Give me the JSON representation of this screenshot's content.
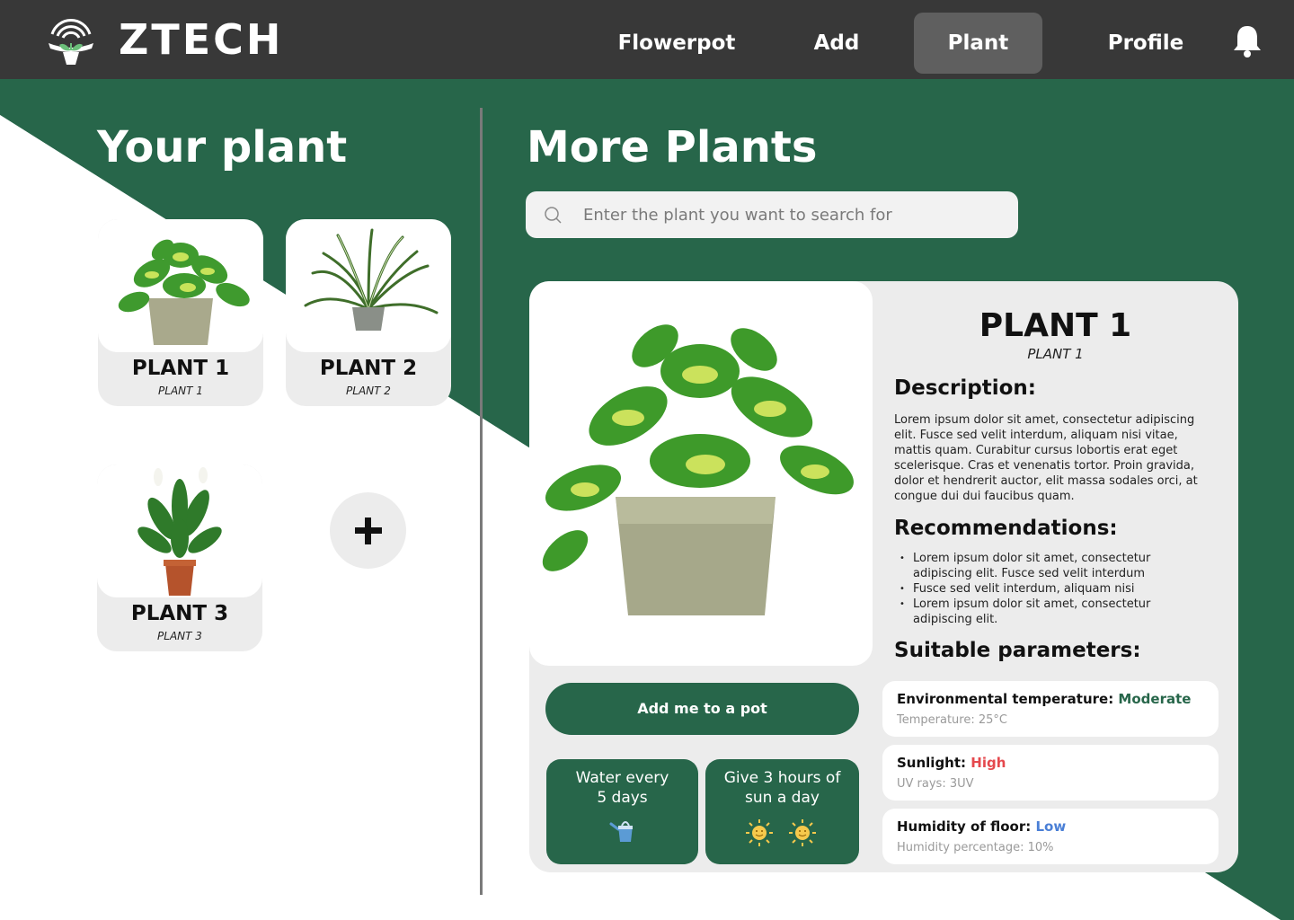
{
  "brand": {
    "name": "ZTECH"
  },
  "nav": {
    "items": [
      {
        "label": "Flowerpot"
      },
      {
        "label": "Add"
      },
      {
        "label": "Plant",
        "active": true
      },
      {
        "label": "Profile"
      }
    ]
  },
  "colors": {
    "header": "#383838",
    "accent": "#27664a",
    "active_tab": "#5f5f5f",
    "high": "#e5484d",
    "moderate": "#27664a",
    "low": "#4a7fd6"
  },
  "your_plants": {
    "title": "Your plant",
    "cards": [
      {
        "name": "PLANT 1",
        "sub": "PLANT 1"
      },
      {
        "name": "PLANT 2",
        "sub": "PLANT 2"
      },
      {
        "name": "PLANT 3",
        "sub": "PLANT 3"
      }
    ],
    "add_icon": "plus-icon"
  },
  "more_plants": {
    "title": "More Plants",
    "search": {
      "placeholder": "Enter the plant you want to search for",
      "value": ""
    }
  },
  "detail": {
    "title": "PLANT 1",
    "sub": "PLANT 1",
    "description_heading": "Description:",
    "description": "Lorem ipsum dolor sit amet, consectetur adipiscing elit. Fusce sed velit interdum, aliquam nisi vitae, mattis quam. Curabitur cursus lobortis erat eget scelerisque. Cras et venenatis tortor. Proin gravida, dolor et hendrerit auctor, elit massa sodales orci, at congue dui dui faucibus quam.",
    "recommendations_heading": "Recommendations:",
    "recommendations": [
      "Lorem ipsum dolor sit amet, consectetur adipiscing elit. Fusce sed velit interdum",
      "Fusce sed velit interdum, aliquam nisi",
      "Lorem ipsum dolor sit amet, consectetur adipiscing elit."
    ],
    "parameters_heading": "Suitable parameters:",
    "parameters": [
      {
        "label": "Environmental temperature: ",
        "value": "Moderate",
        "note": "Temperature: 25°C"
      },
      {
        "label": "Sunlight: ",
        "value": "High",
        "note": "UV rays: 3UV"
      },
      {
        "label": "Humidity of floor: ",
        "value": "Low",
        "note": "Humidity percentage: 10%"
      }
    ],
    "add_button": "Add me to a pot",
    "care": {
      "water_line1": "Water every",
      "water_line2": "5 days",
      "sun_line1": "Give 3 hours of",
      "sun_line2": "sun a day"
    }
  }
}
